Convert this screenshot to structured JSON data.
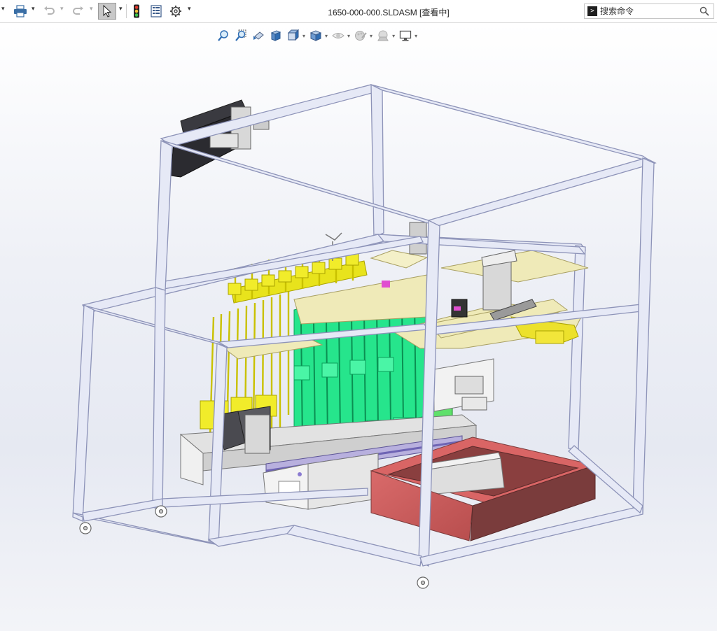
{
  "window": {
    "title": "1650-000-000.SLDASM [查看中]"
  },
  "search": {
    "placeholder": "搜索命令"
  },
  "icons": {
    "toolbar": [
      "print-icon",
      "undo-icon",
      "redo-icon",
      "select-pointer-icon",
      "traffic-light-icon",
      "file-properties-icon",
      "options-gear-icon"
    ],
    "heads_up": [
      "zoom-to-fit-icon",
      "zoom-to-area-icon",
      "previous-view-icon",
      "section-view-icon",
      "view-orientation-icon",
      "display-style-icon",
      "hide-show-items-icon",
      "edit-appearance-icon",
      "apply-scene-icon",
      "view-settings-icon"
    ]
  },
  "colors": {
    "frame_tube": "#e6e9f6",
    "frame_edge": "#8d93b8",
    "yellow_parts": "#e4e21a",
    "green_parts": "#18e886",
    "beige_plates": "#eeeab8",
    "red_box": "#d96565",
    "red_box_dark": "#7a3c3c"
  }
}
